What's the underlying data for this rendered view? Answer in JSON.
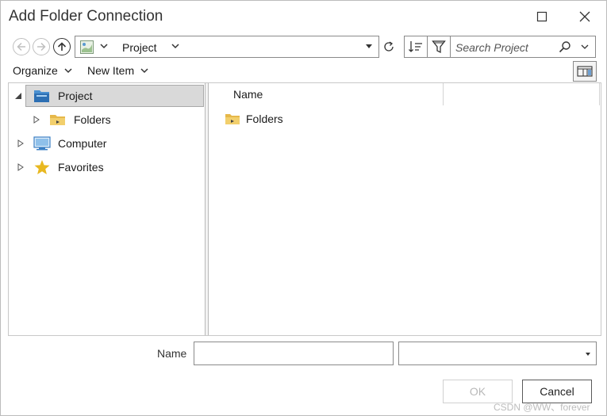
{
  "window": {
    "title": "Add Folder Connection",
    "maximize_icon": "maximize-icon",
    "close_icon": "close-icon"
  },
  "nav": {
    "back_icon": "arrow-left-icon",
    "forward_icon": "arrow-right-icon",
    "up_icon": "arrow-up-icon",
    "location": "Project",
    "refresh_icon": "refresh-icon",
    "sort_icon": "sort-icon",
    "filter_icon": "filter-icon",
    "search_placeholder": "Search Project"
  },
  "menu": {
    "organize_label": "Organize",
    "new_item_label": "New Item",
    "view_icon": "view-options-icon"
  },
  "tree": {
    "items": [
      {
        "label": "Project",
        "icon": "project-icon",
        "expanded": true,
        "selected": true
      },
      {
        "label": "Folders",
        "icon": "folder-icon",
        "expanded": false,
        "selected": false
      },
      {
        "label": "Computer",
        "icon": "computer-icon",
        "expanded": false,
        "selected": false
      },
      {
        "label": "Favorites",
        "icon": "star-icon",
        "expanded": false,
        "selected": false
      }
    ]
  },
  "content": {
    "columns": [
      "Name",
      ""
    ],
    "rows": [
      {
        "name": "Folders",
        "icon": "folder-icon"
      }
    ]
  },
  "footer": {
    "name_label": "Name",
    "name_value": "",
    "type_value": "",
    "ok_label": "OK",
    "cancel_label": "Cancel",
    "ok_enabled": false
  },
  "watermark": "CSDN @WW、forever",
  "colors": {
    "selection": "#d9d9d9",
    "folder": "#e6b84a",
    "project_blue": "#3b7fc4",
    "star": "#e8b820",
    "disabled_text": "#b8b8b8"
  }
}
